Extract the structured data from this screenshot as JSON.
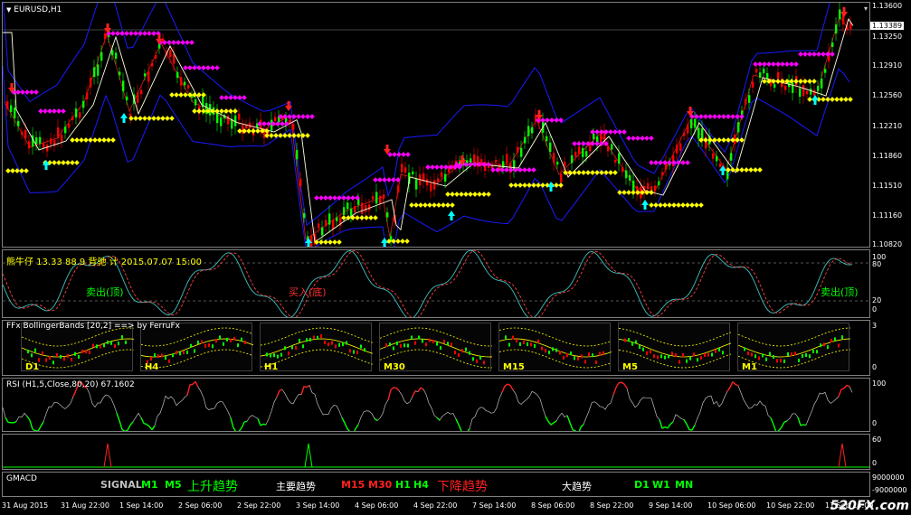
{
  "main_chart": {
    "title": "EURUSD,H1",
    "price_axis": [
      "1.13600",
      "1.13250",
      "1.12910",
      "1.12560",
      "1.12210",
      "1.11860",
      "1.11510",
      "1.11160",
      "1.10820"
    ],
    "current_price": "1.13389"
  },
  "osc_panel": {
    "title": "熊牛仔 13.33 88.9 背驰 计 2015.07.07 15:00",
    "sell_top_label": "卖出(顶)",
    "buy_bottom_label": "买入(底)",
    "sell_top_label2": "卖出(顶)",
    "axis": [
      "100",
      "80",
      "20",
      "0"
    ]
  },
  "bb_panel": {
    "title": "FFx BollingerBands [20,2] ==> by FerruFx",
    "timeframes": [
      "D1",
      "H4",
      "H1",
      "M30",
      "M15",
      "M5",
      "M1"
    ],
    "axis": [
      "3",
      "0"
    ]
  },
  "rsi_panel": {
    "title": "RSI (H1,5,Close,80,20) 67.1602",
    "axis": [
      "100",
      "0"
    ]
  },
  "spike_panel": {
    "axis": [
      "60",
      "0"
    ]
  },
  "gmacd_panel": {
    "title": "GMACD",
    "signal_label": "SIGNAL",
    "m1": "M1",
    "m5": "M5",
    "up_trend": "上升趋势",
    "main_trend": "主要趋势",
    "m15": "M15",
    "m30": "M30",
    "h1": "H1",
    "h4": "H4",
    "down_trend": "下降趋势",
    "big_trend": "大趋势",
    "d1": "D1",
    "w1": "W1",
    "mn": "MN",
    "axis": [
      "9000000",
      "-9000000"
    ]
  },
  "time_axis": [
    "31 Aug 2015",
    "31 Aug 22:00",
    "1 Sep 14:00",
    "2 Sep 06:00",
    "2 Sep 22:00",
    "3 Sep 14:00",
    "4 Sep 06:00",
    "4 Sep 22:00",
    "7 Sep 14:00",
    "8 Sep 06:00",
    "8 Sep 22:00",
    "9 Sep 14:00",
    "10 Sep 06:00",
    "10 Sep 22:00",
    "11 Sep 14:00"
  ],
  "watermark": "520FX.com",
  "colors": {
    "up_candle": "#00ff00",
    "down_candle": "#ff0000",
    "bands": "#1a1aff",
    "signal_magenta": "#ff00ff",
    "signal_yellow": "#ffff00",
    "arrow_cyan": "#00ffff"
  }
}
